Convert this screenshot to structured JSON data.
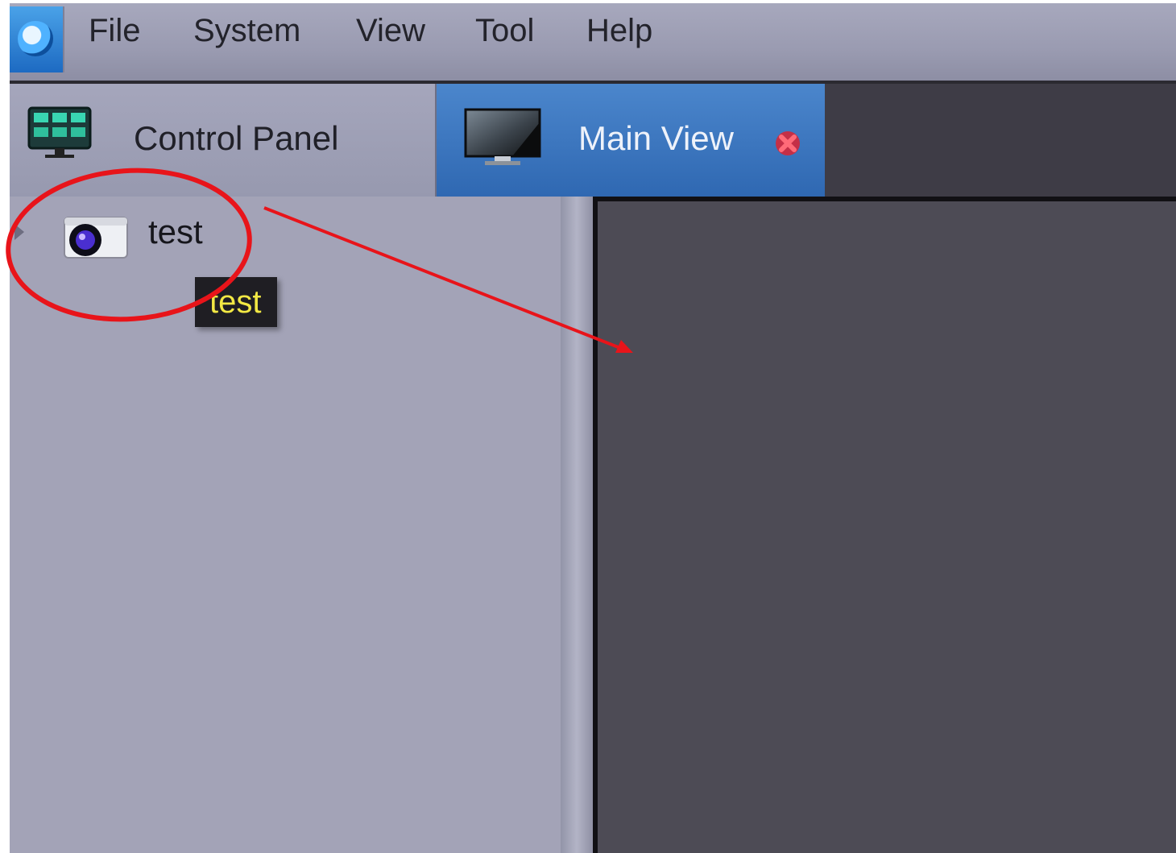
{
  "menu": {
    "items": [
      {
        "label": "File"
      },
      {
        "label": "System"
      },
      {
        "label": "View"
      },
      {
        "label": "Tool"
      },
      {
        "label": "Help"
      }
    ]
  },
  "tabs": {
    "control_panel": {
      "label": "Control Panel"
    },
    "main_view": {
      "label": "Main View"
    }
  },
  "tree": {
    "items": [
      {
        "label": "test"
      }
    ]
  },
  "tooltip": {
    "text": "test"
  },
  "colors": {
    "accent": "#2f68b2",
    "annotation": "#e8141a",
    "tooltip_text": "#f2e844"
  }
}
